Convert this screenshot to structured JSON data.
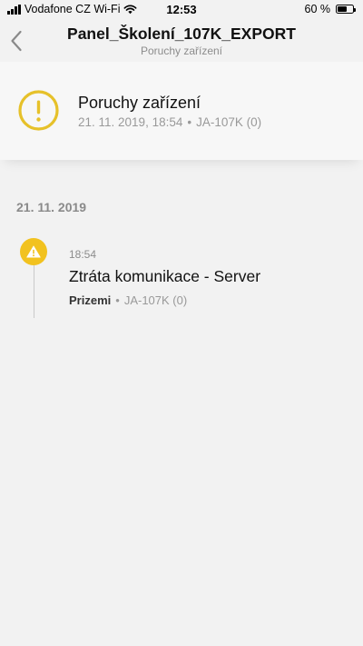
{
  "status_bar": {
    "carrier": "Vodafone CZ Wi-Fi",
    "time": "12:53",
    "battery_text": "60 %",
    "battery_level": 0.6
  },
  "nav": {
    "title": "Panel_Školení_107K_EXPORT",
    "subtitle": "Poruchy zařízení"
  },
  "summary": {
    "title": "Poruchy zařízení",
    "date": "21. 11. 2019, 18:54",
    "separator": "•",
    "device": "JA-107K (0)",
    "icon": "warning-circle-icon",
    "icon_color": "#e6c12a"
  },
  "events": {
    "date_heading": "21. 11. 2019",
    "items": [
      {
        "time": "18:54",
        "title": "Ztráta komunikace - Server",
        "location": "Prizemi",
        "separator": "•",
        "device": "JA-107K (0)",
        "icon": "warning-triangle-icon",
        "icon_color": "#f2c21f"
      }
    ]
  }
}
